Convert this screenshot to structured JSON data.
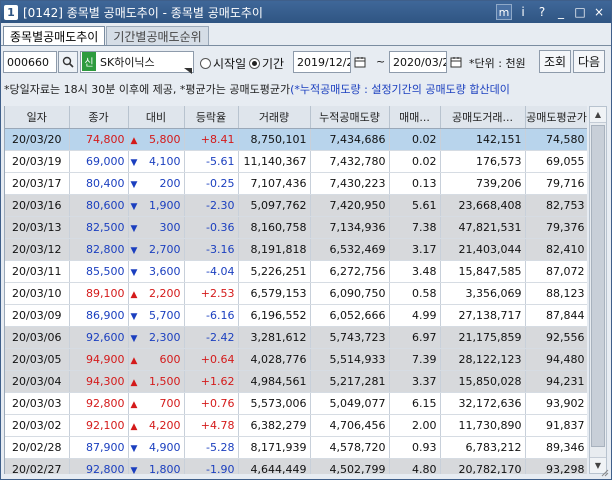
{
  "window": {
    "number": "1",
    "title": "[0142] 종목별 공매도추이 - 종목별 공매도추이",
    "buttons": [
      "m",
      "i",
      "?",
      "_",
      "□",
      "×"
    ]
  },
  "tabs": [
    {
      "label": "종목별공매도추이",
      "active": true
    },
    {
      "label": "기간별공매도순위",
      "active": false
    }
  ],
  "toolbar": {
    "code": "000660",
    "market_badge": "신",
    "stock_name": "SK하이닉스",
    "radio_start": "시작일",
    "radio_period": "기간",
    "date_from": "2019/12/2",
    "tilde": "~",
    "date_to": "2020/03/2",
    "unit_label": "*단위 : 천원",
    "search_button": "조회",
    "next_button": "다음"
  },
  "notice": {
    "text": "*당일자료는 18시 30분 이후에 제공, *평균가는 공매도평균가",
    "highlight": "(*누적공매도량 : 설정기간의 공매도량 합산데이"
  },
  "colors": {
    "up": "#d41a1a",
    "down": "#1b3fbf",
    "selected_row": "#b8d4ec",
    "alt_row": "#d7d9dc"
  },
  "table": {
    "headers": [
      "일자",
      "종가",
      "대비",
      "등락율",
      "거래량",
      "누적공매도량",
      "매매...",
      "공매도거래...",
      "공매도평균가"
    ],
    "rows": [
      {
        "date": "20/03/20",
        "close": "74,800",
        "dir": "up",
        "change": "5,800",
        "rate": "+8.41",
        "volume": "8,750,101",
        "cum": "7,434,686",
        "ratio": "0.02",
        "amount": "142,151",
        "avg": "74,580"
      },
      {
        "date": "20/03/19",
        "close": "69,000",
        "dir": "down",
        "change": "4,100",
        "rate": "-5.61",
        "volume": "11,140,367",
        "cum": "7,432,780",
        "ratio": "0.02",
        "amount": "176,573",
        "avg": "69,055"
      },
      {
        "date": "20/03/17",
        "close": "80,400",
        "dir": "down",
        "change": "200",
        "rate": "-0.25",
        "volume": "7,107,436",
        "cum": "7,430,223",
        "ratio": "0.13",
        "amount": "739,206",
        "avg": "79,716"
      },
      {
        "date": "20/03/16",
        "close": "80,600",
        "dir": "down",
        "change": "1,900",
        "rate": "-2.30",
        "volume": "5,097,762",
        "cum": "7,420,950",
        "ratio": "5.61",
        "amount": "23,668,408",
        "avg": "82,753"
      },
      {
        "date": "20/03/13",
        "close": "82,500",
        "dir": "down",
        "change": "300",
        "rate": "-0.36",
        "volume": "8,160,758",
        "cum": "7,134,936",
        "ratio": "7.38",
        "amount": "47,821,531",
        "avg": "79,376"
      },
      {
        "date": "20/03/12",
        "close": "82,800",
        "dir": "down",
        "change": "2,700",
        "rate": "-3.16",
        "volume": "8,191,818",
        "cum": "6,532,469",
        "ratio": "3.17",
        "amount": "21,403,044",
        "avg": "82,410"
      },
      {
        "date": "20/03/11",
        "close": "85,500",
        "dir": "down",
        "change": "3,600",
        "rate": "-4.04",
        "volume": "5,226,251",
        "cum": "6,272,756",
        "ratio": "3.48",
        "amount": "15,847,585",
        "avg": "87,072"
      },
      {
        "date": "20/03/10",
        "close": "89,100",
        "dir": "up",
        "change": "2,200",
        "rate": "+2.53",
        "volume": "6,579,153",
        "cum": "6,090,750",
        "ratio": "0.58",
        "amount": "3,356,069",
        "avg": "88,123"
      },
      {
        "date": "20/03/09",
        "close": "86,900",
        "dir": "down",
        "change": "5,700",
        "rate": "-6.16",
        "volume": "6,196,552",
        "cum": "6,052,666",
        "ratio": "4.99",
        "amount": "27,138,717",
        "avg": "87,844"
      },
      {
        "date": "20/03/06",
        "close": "92,600",
        "dir": "down",
        "change": "2,300",
        "rate": "-2.42",
        "volume": "3,281,612",
        "cum": "5,743,723",
        "ratio": "6.97",
        "amount": "21,175,859",
        "avg": "92,556"
      },
      {
        "date": "20/03/05",
        "close": "94,900",
        "dir": "up",
        "change": "600",
        "rate": "+0.64",
        "volume": "4,028,776",
        "cum": "5,514,933",
        "ratio": "7.39",
        "amount": "28,122,123",
        "avg": "94,480"
      },
      {
        "date": "20/03/04",
        "close": "94,300",
        "dir": "up",
        "change": "1,500",
        "rate": "+1.62",
        "volume": "4,984,561",
        "cum": "5,217,281",
        "ratio": "3.37",
        "amount": "15,850,028",
        "avg": "94,231"
      },
      {
        "date": "20/03/03",
        "close": "92,800",
        "dir": "up",
        "change": "700",
        "rate": "+0.76",
        "volume": "5,573,006",
        "cum": "5,049,077",
        "ratio": "6.15",
        "amount": "32,172,636",
        "avg": "93,902"
      },
      {
        "date": "20/03/02",
        "close": "92,100",
        "dir": "up",
        "change": "4,200",
        "rate": "+4.78",
        "volume": "6,382,279",
        "cum": "4,706,456",
        "ratio": "2.00",
        "amount": "11,730,890",
        "avg": "91,837"
      },
      {
        "date": "20/02/28",
        "close": "87,900",
        "dir": "down",
        "change": "4,900",
        "rate": "-5.28",
        "volume": "8,171,939",
        "cum": "4,578,720",
        "ratio": "0.93",
        "amount": "6,783,212",
        "avg": "89,346"
      },
      {
        "date": "20/02/27",
        "close": "92,800",
        "dir": "down",
        "change": "1,800",
        "rate": "-1.90",
        "volume": "4,644,449",
        "cum": "4,502,799",
        "ratio": "4.80",
        "amount": "20,782,170",
        "avg": "93,298"
      }
    ]
  }
}
